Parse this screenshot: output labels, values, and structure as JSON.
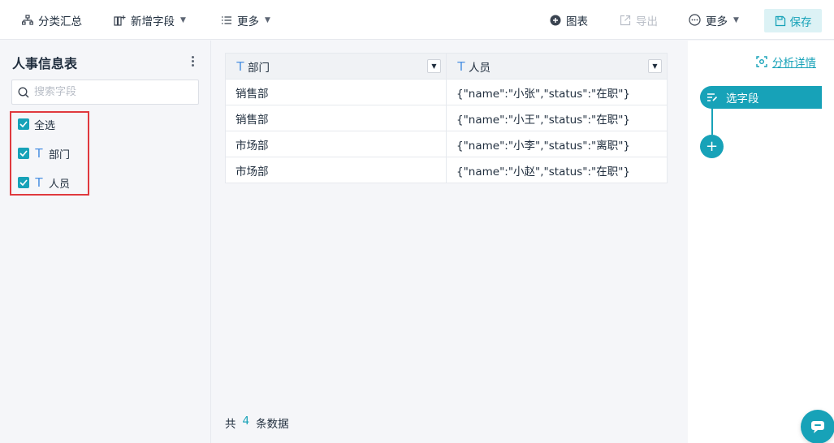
{
  "toolbar": {
    "group_summary": "分类汇总",
    "add_field": "新增字段",
    "more_left": "更多",
    "chart": "图表",
    "export": "导出",
    "more_right": "更多",
    "save": "保存"
  },
  "left_panel": {
    "title": "人事信息表",
    "search_placeholder": "搜索字段",
    "select_all": "全选",
    "fields": [
      "部门",
      "人员"
    ]
  },
  "table": {
    "columns": [
      "部门",
      "人员"
    ],
    "rows": [
      [
        "销售部",
        "{\"name\":\"小张\",\"status\":\"在职\"}"
      ],
      [
        "销售部",
        "{\"name\":\"小王\",\"status\":\"在职\"}"
      ],
      [
        "市场部",
        "{\"name\":\"小李\",\"status\":\"离职\"}"
      ],
      [
        "市场部",
        "{\"name\":\"小赵\",\"status\":\"在职\"}"
      ]
    ]
  },
  "footer": {
    "prefix": "共",
    "count": "4",
    "suffix": "条数据"
  },
  "right_panel": {
    "analysis_link": "分析详情",
    "step_label": "选字段",
    "add_step": "+"
  },
  "colors": {
    "accent": "#17a2b8",
    "highlight_border": "#e0393e",
    "field_type_icon": "#4a90e2"
  }
}
